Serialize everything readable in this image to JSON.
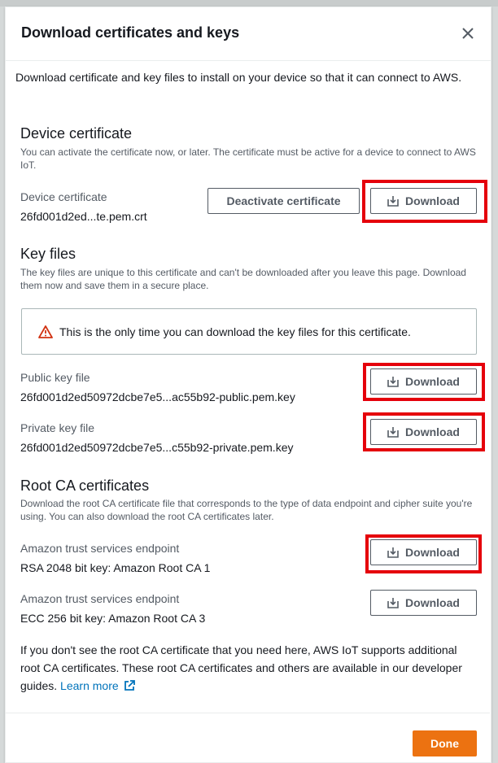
{
  "modal": {
    "title": "Download certificates and keys",
    "close_icon": "close-icon",
    "intro": "Download certificate and key files to install on your device so that it can connect to AWS."
  },
  "device_cert": {
    "heading": "Device certificate",
    "description": "You can activate the certificate now, or later. The certificate must be active for a device to connect to AWS IoT.",
    "label": "Device certificate",
    "filename": "26fd001d2ed...te.pem.crt",
    "deactivate_label": "Deactivate certificate",
    "download_label": "Download"
  },
  "key_files": {
    "heading": "Key files",
    "description": "The key files are unique to this certificate and can't be downloaded after you leave this page. Download them now and save them in a secure place.",
    "alert": "This is the only time you can download the key files for this certificate.",
    "public_label": "Public key file",
    "public_filename": "26fd001d2ed50972dcbe7e5...ac55b92-public.pem.key",
    "private_label": "Private key file",
    "private_filename": "26fd001d2ed50972dcbe7e5...c55b92-private.pem.key",
    "download_label": "Download"
  },
  "root_ca": {
    "heading": "Root CA certificates",
    "description": "Download the root CA certificate file that corresponds to the type of data endpoint and cipher suite you're using. You can also download the root CA certificates later.",
    "rsa_label": "Amazon trust services endpoint",
    "rsa_value": "RSA 2048 bit key: Amazon Root CA 1",
    "ecc_label": "Amazon trust services endpoint",
    "ecc_value": "ECC 256 bit key: Amazon Root CA 3",
    "download_label": "Download",
    "footer_text": "If you don't see the root CA certificate that you need here, AWS IoT supports additional root CA certificates. These root CA certificates and others are available in our developer guides.",
    "learn_more": "Learn more"
  },
  "footer": {
    "done_label": "Done"
  },
  "colors": {
    "highlight": "#e5000b",
    "primary": "#ec7211",
    "link": "#0073bb",
    "warning": "#d13212"
  }
}
